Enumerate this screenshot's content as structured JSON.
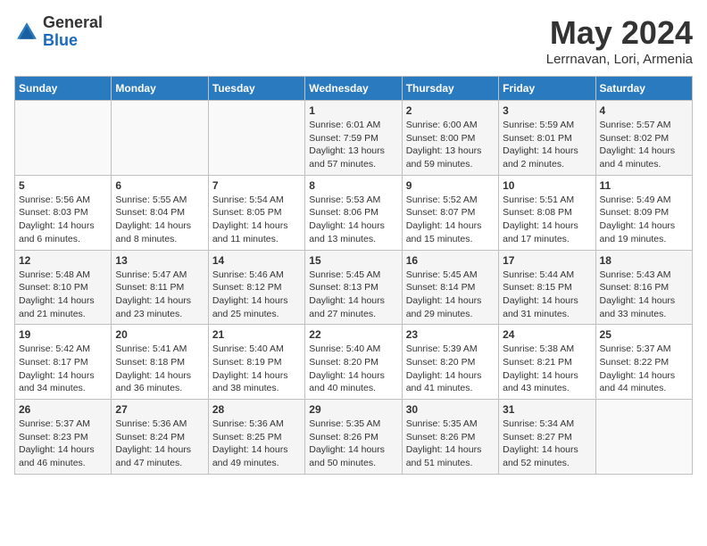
{
  "header": {
    "logo_general": "General",
    "logo_blue": "Blue",
    "month_title": "May 2024",
    "location": "Lerrnavan, Lori, Armenia"
  },
  "weekdays": [
    "Sunday",
    "Monday",
    "Tuesday",
    "Wednesday",
    "Thursday",
    "Friday",
    "Saturday"
  ],
  "weeks": [
    [
      {
        "day": "",
        "sunrise": "",
        "sunset": "",
        "daylight": ""
      },
      {
        "day": "",
        "sunrise": "",
        "sunset": "",
        "daylight": ""
      },
      {
        "day": "",
        "sunrise": "",
        "sunset": "",
        "daylight": ""
      },
      {
        "day": "1",
        "sunrise": "Sunrise: 6:01 AM",
        "sunset": "Sunset: 7:59 PM",
        "daylight": "Daylight: 13 hours and 57 minutes."
      },
      {
        "day": "2",
        "sunrise": "Sunrise: 6:00 AM",
        "sunset": "Sunset: 8:00 PM",
        "daylight": "Daylight: 13 hours and 59 minutes."
      },
      {
        "day": "3",
        "sunrise": "Sunrise: 5:59 AM",
        "sunset": "Sunset: 8:01 PM",
        "daylight": "Daylight: 14 hours and 2 minutes."
      },
      {
        "day": "4",
        "sunrise": "Sunrise: 5:57 AM",
        "sunset": "Sunset: 8:02 PM",
        "daylight": "Daylight: 14 hours and 4 minutes."
      }
    ],
    [
      {
        "day": "5",
        "sunrise": "Sunrise: 5:56 AM",
        "sunset": "Sunset: 8:03 PM",
        "daylight": "Daylight: 14 hours and 6 minutes."
      },
      {
        "day": "6",
        "sunrise": "Sunrise: 5:55 AM",
        "sunset": "Sunset: 8:04 PM",
        "daylight": "Daylight: 14 hours and 8 minutes."
      },
      {
        "day": "7",
        "sunrise": "Sunrise: 5:54 AM",
        "sunset": "Sunset: 8:05 PM",
        "daylight": "Daylight: 14 hours and 11 minutes."
      },
      {
        "day": "8",
        "sunrise": "Sunrise: 5:53 AM",
        "sunset": "Sunset: 8:06 PM",
        "daylight": "Daylight: 14 hours and 13 minutes."
      },
      {
        "day": "9",
        "sunrise": "Sunrise: 5:52 AM",
        "sunset": "Sunset: 8:07 PM",
        "daylight": "Daylight: 14 hours and 15 minutes."
      },
      {
        "day": "10",
        "sunrise": "Sunrise: 5:51 AM",
        "sunset": "Sunset: 8:08 PM",
        "daylight": "Daylight: 14 hours and 17 minutes."
      },
      {
        "day": "11",
        "sunrise": "Sunrise: 5:49 AM",
        "sunset": "Sunset: 8:09 PM",
        "daylight": "Daylight: 14 hours and 19 minutes."
      }
    ],
    [
      {
        "day": "12",
        "sunrise": "Sunrise: 5:48 AM",
        "sunset": "Sunset: 8:10 PM",
        "daylight": "Daylight: 14 hours and 21 minutes."
      },
      {
        "day": "13",
        "sunrise": "Sunrise: 5:47 AM",
        "sunset": "Sunset: 8:11 PM",
        "daylight": "Daylight: 14 hours and 23 minutes."
      },
      {
        "day": "14",
        "sunrise": "Sunrise: 5:46 AM",
        "sunset": "Sunset: 8:12 PM",
        "daylight": "Daylight: 14 hours and 25 minutes."
      },
      {
        "day": "15",
        "sunrise": "Sunrise: 5:45 AM",
        "sunset": "Sunset: 8:13 PM",
        "daylight": "Daylight: 14 hours and 27 minutes."
      },
      {
        "day": "16",
        "sunrise": "Sunrise: 5:45 AM",
        "sunset": "Sunset: 8:14 PM",
        "daylight": "Daylight: 14 hours and 29 minutes."
      },
      {
        "day": "17",
        "sunrise": "Sunrise: 5:44 AM",
        "sunset": "Sunset: 8:15 PM",
        "daylight": "Daylight: 14 hours and 31 minutes."
      },
      {
        "day": "18",
        "sunrise": "Sunrise: 5:43 AM",
        "sunset": "Sunset: 8:16 PM",
        "daylight": "Daylight: 14 hours and 33 minutes."
      }
    ],
    [
      {
        "day": "19",
        "sunrise": "Sunrise: 5:42 AM",
        "sunset": "Sunset: 8:17 PM",
        "daylight": "Daylight: 14 hours and 34 minutes."
      },
      {
        "day": "20",
        "sunrise": "Sunrise: 5:41 AM",
        "sunset": "Sunset: 8:18 PM",
        "daylight": "Daylight: 14 hours and 36 minutes."
      },
      {
        "day": "21",
        "sunrise": "Sunrise: 5:40 AM",
        "sunset": "Sunset: 8:19 PM",
        "daylight": "Daylight: 14 hours and 38 minutes."
      },
      {
        "day": "22",
        "sunrise": "Sunrise: 5:40 AM",
        "sunset": "Sunset: 8:20 PM",
        "daylight": "Daylight: 14 hours and 40 minutes."
      },
      {
        "day": "23",
        "sunrise": "Sunrise: 5:39 AM",
        "sunset": "Sunset: 8:20 PM",
        "daylight": "Daylight: 14 hours and 41 minutes."
      },
      {
        "day": "24",
        "sunrise": "Sunrise: 5:38 AM",
        "sunset": "Sunset: 8:21 PM",
        "daylight": "Daylight: 14 hours and 43 minutes."
      },
      {
        "day": "25",
        "sunrise": "Sunrise: 5:37 AM",
        "sunset": "Sunset: 8:22 PM",
        "daylight": "Daylight: 14 hours and 44 minutes."
      }
    ],
    [
      {
        "day": "26",
        "sunrise": "Sunrise: 5:37 AM",
        "sunset": "Sunset: 8:23 PM",
        "daylight": "Daylight: 14 hours and 46 minutes."
      },
      {
        "day": "27",
        "sunrise": "Sunrise: 5:36 AM",
        "sunset": "Sunset: 8:24 PM",
        "daylight": "Daylight: 14 hours and 47 minutes."
      },
      {
        "day": "28",
        "sunrise": "Sunrise: 5:36 AM",
        "sunset": "Sunset: 8:25 PM",
        "daylight": "Daylight: 14 hours and 49 minutes."
      },
      {
        "day": "29",
        "sunrise": "Sunrise: 5:35 AM",
        "sunset": "Sunset: 8:26 PM",
        "daylight": "Daylight: 14 hours and 50 minutes."
      },
      {
        "day": "30",
        "sunrise": "Sunrise: 5:35 AM",
        "sunset": "Sunset: 8:26 PM",
        "daylight": "Daylight: 14 hours and 51 minutes."
      },
      {
        "day": "31",
        "sunrise": "Sunrise: 5:34 AM",
        "sunset": "Sunset: 8:27 PM",
        "daylight": "Daylight: 14 hours and 52 minutes."
      },
      {
        "day": "",
        "sunrise": "",
        "sunset": "",
        "daylight": ""
      }
    ]
  ]
}
